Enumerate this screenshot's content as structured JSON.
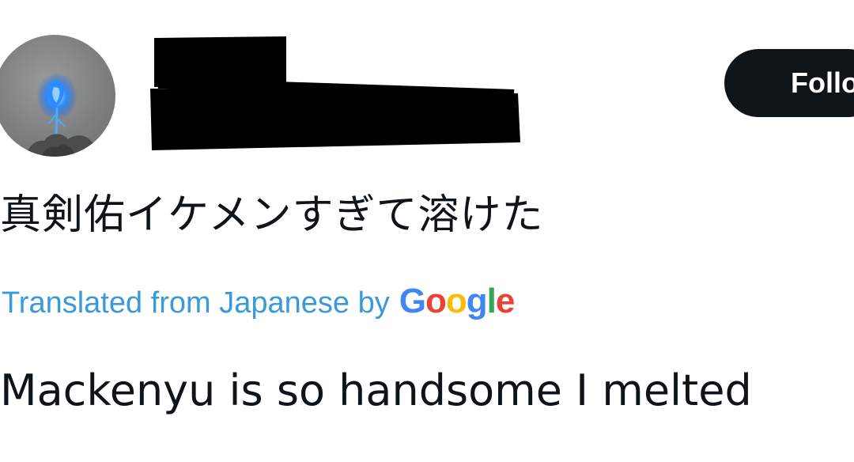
{
  "header": {
    "follow_label": "Follow",
    "avatar_icon": "blue-flame-avatar",
    "username_redacted": true
  },
  "tweet": {
    "original_text": "真剣佑イケメンすぎて溶けた",
    "translation_label": "Translated from Japanese by",
    "translation_provider": {
      "letters": [
        "G",
        "o",
        "o",
        "g",
        "l",
        "e"
      ],
      "colors": [
        "#4285F4",
        "#EA4335",
        "#FBBC05",
        "#4285F4",
        "#34A853",
        "#EA4335"
      ]
    },
    "translated_text": "Mackenyu is so handsome I melted"
  },
  "colors": {
    "link": "#3a9ad9",
    "text": "#0f1419",
    "button_bg": "#0f1419"
  }
}
